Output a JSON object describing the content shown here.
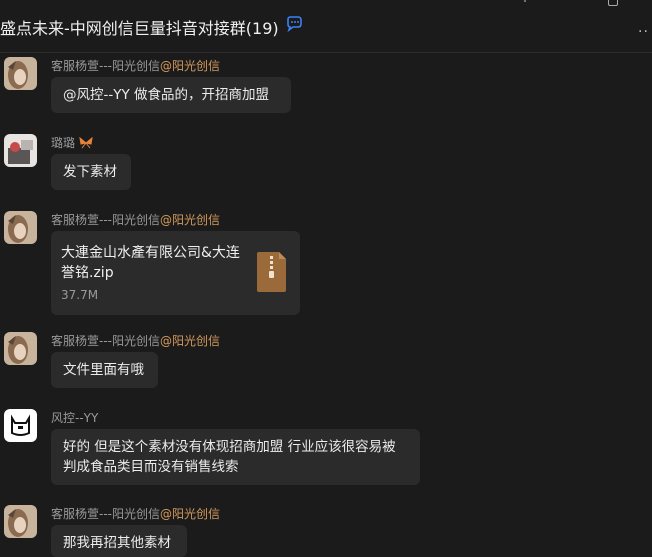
{
  "header": {
    "title": "盛点未来-中网创信巨量抖音对接群(19)"
  },
  "messages": [
    {
      "sender": "客服杨萱---阳光创信",
      "tag": "@阳光创信",
      "text": "@风控--YY 做食品的，开招商加盟"
    },
    {
      "sender": "璐璐",
      "tag": "",
      "text": "发下素材"
    },
    {
      "sender": "客服杨萱---阳光创信",
      "tag": "@阳光创信",
      "file": {
        "name": "大連金山水產有限公司&大连誉铭.zip",
        "size": "37.7M"
      }
    },
    {
      "sender": "客服杨萱---阳光创信",
      "tag": "@阳光创信",
      "text": "文件里面有哦"
    },
    {
      "sender": "风控--YY",
      "tag": "",
      "text_line1": "好的 但是这个素材没有体现招商加盟 行业应该很容易被",
      "text_line2": "判成食品类目而没有销售线索"
    },
    {
      "sender": "客服杨萱---阳光创信",
      "tag": "@阳光创信",
      "text": "那我再招其他素材"
    }
  ],
  "colors": {
    "background": "#1b1b1b",
    "bubble": "#2b2b2b",
    "tag": "#d39a5c",
    "sender": "#9a9a9a"
  },
  "icons": {
    "title": "chat-bubble-icon",
    "more": "more-dots-icon",
    "file": "zip-file-icon"
  }
}
